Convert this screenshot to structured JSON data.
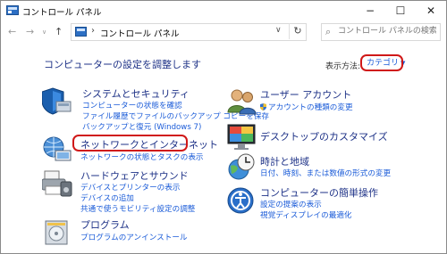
{
  "window": {
    "title": "コントロール パネル"
  },
  "nav": {
    "back": "←",
    "forward": "→",
    "up": "↑",
    "separator": "›",
    "crumb": "コントロール パネル",
    "dropdown": "∨",
    "refresh": "↻"
  },
  "search": {
    "placeholder": "コントロール パネルの検索"
  },
  "main": {
    "title": "コンピューターの設定を調整します",
    "view_by_label": "表示方法:",
    "view_by_value": "カテゴリ",
    "view_caret": "▼"
  },
  "categories": {
    "system": {
      "title": "システムとセキュリティ",
      "links": [
        "コンピューターの状態を確認",
        "ファイル履歴でファイルのバックアップ コピーを保存",
        "バックアップと復元 (Windows 7)"
      ]
    },
    "network": {
      "title": "ネットワークとインターネット",
      "links": [
        "ネットワークの状態とタスクの表示"
      ]
    },
    "hardware": {
      "title": "ハードウェアとサウンド",
      "links": [
        "デバイスとプリンターの表示",
        "デバイスの追加",
        "共通で使うモビリティ設定の調整"
      ]
    },
    "programs": {
      "title": "プログラム",
      "links": [
        "プログラムのアンインストール"
      ]
    },
    "users": {
      "title": "ユーザー アカウント",
      "links": [
        "アカウントの種類の変更"
      ]
    },
    "appearance": {
      "title": "デスクトップのカスタマイズ",
      "links": []
    },
    "clock": {
      "title": "時計と地域",
      "links": [
        "日付、時刻、または数値の形式の変更"
      ]
    },
    "ease": {
      "title": "コンピューターの簡単操作",
      "links": [
        "設定の提案の表示",
        "視覚ディスプレイの最適化"
      ]
    }
  },
  "colors": {
    "heading": "#1e3287",
    "link": "#1a5bd8",
    "highlight": "#d01818"
  }
}
